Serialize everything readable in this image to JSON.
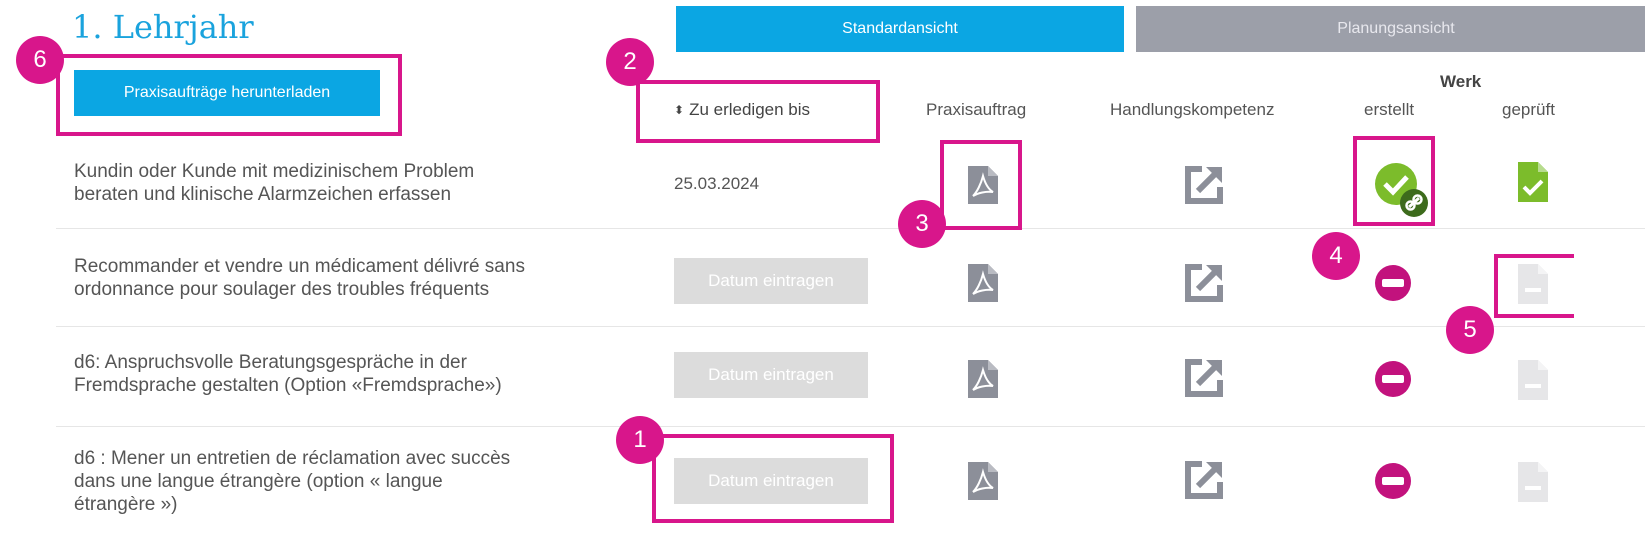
{
  "header": {
    "title": "1. Lehrjahr",
    "download_label": "Praxisaufträge herunterladen",
    "view_standard": "Standardansicht",
    "view_planning": "Planungsansicht"
  },
  "columns": {
    "sort_arrows": "⬍",
    "due": "Zu erledigen bis",
    "task": "Praxisauftrag",
    "competence": "Handlungskompetenz",
    "werk": "Werk",
    "created": "erstellt",
    "checked": "geprüft"
  },
  "rows": [
    {
      "line1": "Kundin oder Kunde mit medizinischem Problem",
      "line2": "beraten und klinische Alarmzeichen erfassen",
      "line3": "",
      "due": "25.03.2024",
      "created": "done-linked",
      "checked": "done"
    },
    {
      "line1": "Recommander et vendre un médicament délivré sans",
      "line2": "ordonnance pour soulager des troubles fréquents",
      "line3": "",
      "due_button": "Datum eintragen",
      "created": "missing",
      "checked": "pending"
    },
    {
      "line1": "d6: Anspruchsvolle Beratungsgespräche in der",
      "line2": "Fremdsprache gestalten (Option «Fremdsprache»)",
      "line3": "",
      "due_button": "Datum eintragen",
      "created": "missing",
      "checked": "pending"
    },
    {
      "line1": "d6 : Mener un entretien de réclamation avec succès",
      "line2": "dans une langue étrangère (option « langue",
      "line3": "étrangère »)",
      "due_button": "Datum eintragen",
      "created": "missing",
      "checked": "pending"
    }
  ],
  "annotations": [
    "1",
    "2",
    "3",
    "4",
    "5",
    "6"
  ],
  "colors": {
    "accent": "#0ba6e3",
    "highlight": "#d8168b",
    "success": "#7cbc2b",
    "missing": "#c2127d",
    "disabled": "#dcdcdc",
    "icon_gray": "#8c8f99"
  },
  "icons": [
    "pdf-icon",
    "external-link-icon",
    "check-circle-icon",
    "link-icon",
    "minus-circle-icon",
    "document-check-icon",
    "document-icon"
  ]
}
